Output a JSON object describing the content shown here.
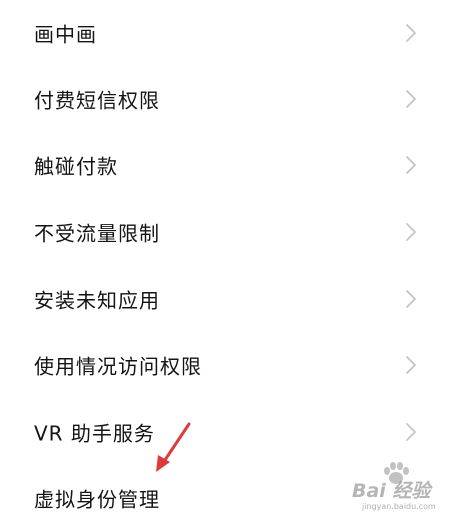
{
  "settings_list": {
    "items": [
      {
        "label": "画中画"
      },
      {
        "label": "付费短信权限"
      },
      {
        "label": "触碰付款"
      },
      {
        "label": "不受流量限制"
      },
      {
        "label": "安装未知应用"
      },
      {
        "label": "使用情况访问权限"
      },
      {
        "label": "VR 助手服务"
      },
      {
        "label": "虚拟身份管理"
      }
    ]
  },
  "colors": {
    "text": "#141414",
    "chevron": "#c4c4c4",
    "annotation_arrow": "#e03a3a",
    "background": "#ffffff"
  },
  "watermark": {
    "brand": "Bai 经验",
    "url": "jingyan.baidu.com"
  }
}
